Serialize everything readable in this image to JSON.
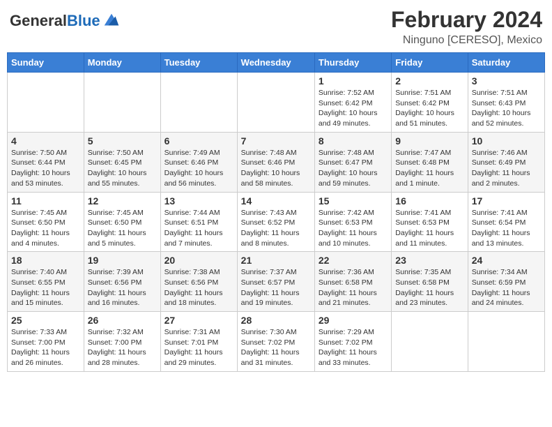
{
  "header": {
    "logo_general": "General",
    "logo_blue": "Blue",
    "month_title": "February 2024",
    "location": "Ninguno [CERESO], Mexico"
  },
  "weekdays": [
    "Sunday",
    "Monday",
    "Tuesday",
    "Wednesday",
    "Thursday",
    "Friday",
    "Saturday"
  ],
  "weeks": [
    [
      {
        "day": "",
        "info": ""
      },
      {
        "day": "",
        "info": ""
      },
      {
        "day": "",
        "info": ""
      },
      {
        "day": "",
        "info": ""
      },
      {
        "day": "1",
        "info": "Sunrise: 7:52 AM\nSunset: 6:42 PM\nDaylight: 10 hours and 49 minutes."
      },
      {
        "day": "2",
        "info": "Sunrise: 7:51 AM\nSunset: 6:42 PM\nDaylight: 10 hours and 51 minutes."
      },
      {
        "day": "3",
        "info": "Sunrise: 7:51 AM\nSunset: 6:43 PM\nDaylight: 10 hours and 52 minutes."
      }
    ],
    [
      {
        "day": "4",
        "info": "Sunrise: 7:50 AM\nSunset: 6:44 PM\nDaylight: 10 hours and 53 minutes."
      },
      {
        "day": "5",
        "info": "Sunrise: 7:50 AM\nSunset: 6:45 PM\nDaylight: 10 hours and 55 minutes."
      },
      {
        "day": "6",
        "info": "Sunrise: 7:49 AM\nSunset: 6:46 PM\nDaylight: 10 hours and 56 minutes."
      },
      {
        "day": "7",
        "info": "Sunrise: 7:48 AM\nSunset: 6:46 PM\nDaylight: 10 hours and 58 minutes."
      },
      {
        "day": "8",
        "info": "Sunrise: 7:48 AM\nSunset: 6:47 PM\nDaylight: 10 hours and 59 minutes."
      },
      {
        "day": "9",
        "info": "Sunrise: 7:47 AM\nSunset: 6:48 PM\nDaylight: 11 hours and 1 minute."
      },
      {
        "day": "10",
        "info": "Sunrise: 7:46 AM\nSunset: 6:49 PM\nDaylight: 11 hours and 2 minutes."
      }
    ],
    [
      {
        "day": "11",
        "info": "Sunrise: 7:45 AM\nSunset: 6:50 PM\nDaylight: 11 hours and 4 minutes."
      },
      {
        "day": "12",
        "info": "Sunrise: 7:45 AM\nSunset: 6:50 PM\nDaylight: 11 hours and 5 minutes."
      },
      {
        "day": "13",
        "info": "Sunrise: 7:44 AM\nSunset: 6:51 PM\nDaylight: 11 hours and 7 minutes."
      },
      {
        "day": "14",
        "info": "Sunrise: 7:43 AM\nSunset: 6:52 PM\nDaylight: 11 hours and 8 minutes."
      },
      {
        "day": "15",
        "info": "Sunrise: 7:42 AM\nSunset: 6:53 PM\nDaylight: 11 hours and 10 minutes."
      },
      {
        "day": "16",
        "info": "Sunrise: 7:41 AM\nSunset: 6:53 PM\nDaylight: 11 hours and 11 minutes."
      },
      {
        "day": "17",
        "info": "Sunrise: 7:41 AM\nSunset: 6:54 PM\nDaylight: 11 hours and 13 minutes."
      }
    ],
    [
      {
        "day": "18",
        "info": "Sunrise: 7:40 AM\nSunset: 6:55 PM\nDaylight: 11 hours and 15 minutes."
      },
      {
        "day": "19",
        "info": "Sunrise: 7:39 AM\nSunset: 6:56 PM\nDaylight: 11 hours and 16 minutes."
      },
      {
        "day": "20",
        "info": "Sunrise: 7:38 AM\nSunset: 6:56 PM\nDaylight: 11 hours and 18 minutes."
      },
      {
        "day": "21",
        "info": "Sunrise: 7:37 AM\nSunset: 6:57 PM\nDaylight: 11 hours and 19 minutes."
      },
      {
        "day": "22",
        "info": "Sunrise: 7:36 AM\nSunset: 6:58 PM\nDaylight: 11 hours and 21 minutes."
      },
      {
        "day": "23",
        "info": "Sunrise: 7:35 AM\nSunset: 6:58 PM\nDaylight: 11 hours and 23 minutes."
      },
      {
        "day": "24",
        "info": "Sunrise: 7:34 AM\nSunset: 6:59 PM\nDaylight: 11 hours and 24 minutes."
      }
    ],
    [
      {
        "day": "25",
        "info": "Sunrise: 7:33 AM\nSunset: 7:00 PM\nDaylight: 11 hours and 26 minutes."
      },
      {
        "day": "26",
        "info": "Sunrise: 7:32 AM\nSunset: 7:00 PM\nDaylight: 11 hours and 28 minutes."
      },
      {
        "day": "27",
        "info": "Sunrise: 7:31 AM\nSunset: 7:01 PM\nDaylight: 11 hours and 29 minutes."
      },
      {
        "day": "28",
        "info": "Sunrise: 7:30 AM\nSunset: 7:02 PM\nDaylight: 11 hours and 31 minutes."
      },
      {
        "day": "29",
        "info": "Sunrise: 7:29 AM\nSunset: 7:02 PM\nDaylight: 11 hours and 33 minutes."
      },
      {
        "day": "",
        "info": ""
      },
      {
        "day": "",
        "info": ""
      }
    ]
  ]
}
